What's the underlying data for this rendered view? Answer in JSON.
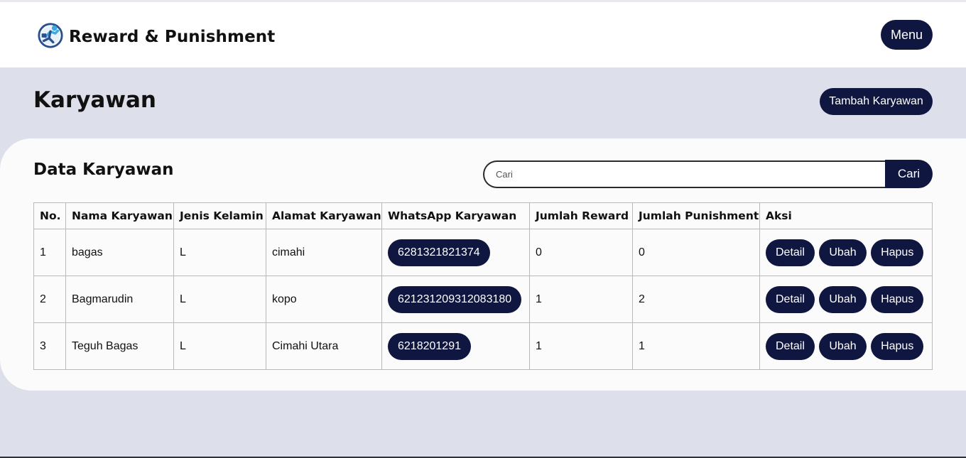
{
  "header": {
    "brand_title": "Reward & Punishment",
    "menu_label": "Menu"
  },
  "page": {
    "title": "Karyawan",
    "add_button_label": "Tambah Karyawan"
  },
  "card": {
    "title": "Data Karyawan",
    "search": {
      "placeholder": "Cari",
      "value": "",
      "button_label": "Cari"
    }
  },
  "table": {
    "columns": [
      "No.",
      "Nama Karyawan",
      "Jenis Kelamin",
      "Alamat Karyawan",
      "WhatsApp Karyawan",
      "Jumlah Reward",
      "Jumlah Punishment",
      "Aksi"
    ],
    "rows": [
      {
        "no": "1",
        "nama": "bagas",
        "jk": "L",
        "alamat": "cimahi",
        "wa": "6281321821374",
        "reward": "0",
        "punishment": "0"
      },
      {
        "no": "2",
        "nama": "Bagmarudin",
        "jk": "L",
        "alamat": "kopo",
        "wa": "621231209312083180",
        "reward": "1",
        "punishment": "2"
      },
      {
        "no": "3",
        "nama": "Teguh Bagas",
        "jk": "L",
        "alamat": "Cimahi Utara",
        "wa": "6218201291",
        "reward": "1",
        "punishment": "1"
      }
    ],
    "actions": {
      "detail": "Detail",
      "edit": "Ubah",
      "delete": "Hapus"
    }
  },
  "colors": {
    "primary": "#0f1640",
    "background": "#dddfea",
    "card": "#fbfbfb"
  },
  "icons": {
    "logo": "running-person-logo-icon"
  }
}
